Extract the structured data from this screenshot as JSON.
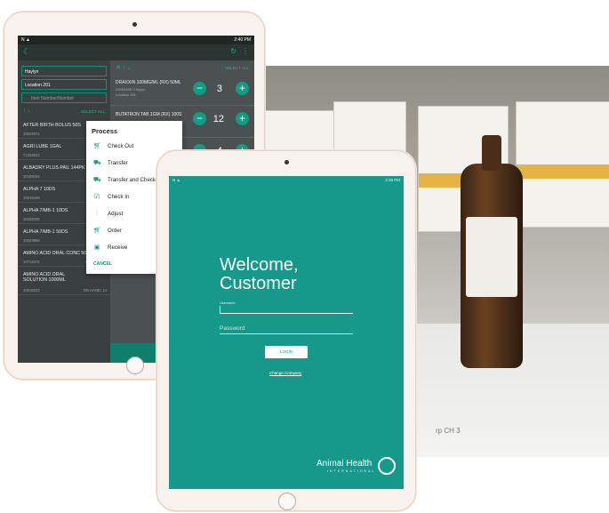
{
  "back_tablet": {
    "status_time": "2:40 PM",
    "filters": {
      "user": "Haylyn",
      "location": "Location 201",
      "item_number_placeholder": "Item Number/Number"
    },
    "select_all_left": "SELECT ALL",
    "select_all_right": "SELECT ALL",
    "items": [
      {
        "name": "AFTER BIRTH BOLUS 50S",
        "code": "10026971",
        "onhand": "ON"
      },
      {
        "name": "AGRI LUBE 1GAL",
        "code": "71263533",
        "onhand": "ON"
      },
      {
        "name": "ALBADRY PLUS PAIL 144PK",
        "code": "10189464",
        "onhand": "ON"
      },
      {
        "name": "ALPHA 7 10DS",
        "code": "10015449",
        "onhand": "ON"
      },
      {
        "name": "ALPHA 7/MB-1 10DS",
        "code": "10158425",
        "onhand": "ON"
      },
      {
        "name": "ALPHA 7/MB-1 50DS",
        "code": "10029956",
        "onhand": "ON"
      },
      {
        "name": "AMINO ACID ORAL CONC 500ML",
        "code": "10711676",
        "onhand": "ON HAND: 8"
      },
      {
        "name": "AMINO ACID ORAL SOLUTION 1000ML",
        "code": "10016223",
        "onhand": "ON HAND: 14"
      }
    ],
    "selected": [
      {
        "name": "DRAXXIN 100MG/ML (RX) 50ML",
        "sub1": "10050465 / Haylyn",
        "sub2": "Location 201",
        "qty": "3"
      },
      {
        "name": "BUTATRON TAB 1GM (RX) 100S",
        "sub1": "",
        "sub2": "",
        "qty": "12"
      },
      {
        "name": "",
        "sub1": "",
        "sub2": "",
        "qty": "4"
      }
    ],
    "menu": {
      "title": "Process",
      "items": [
        {
          "icon": "cart-icon",
          "label": "Check Out"
        },
        {
          "icon": "truck-icon",
          "label": "Transfer"
        },
        {
          "icon": "truck-icon",
          "label": "Transfer and Check C"
        },
        {
          "icon": "check-icon",
          "label": "Check In"
        },
        {
          "icon": "sliders-icon",
          "label": "Adjust"
        },
        {
          "icon": "cart-icon",
          "label": "Order"
        },
        {
          "icon": "box-icon",
          "label": "Receive"
        }
      ],
      "cancel": "CANCEL"
    }
  },
  "front_tablet": {
    "status_time": "2:39 PM",
    "welcome_line1": "Welcome,",
    "welcome_line2": "Customer",
    "username_label": "Username",
    "password_placeholder": "Password",
    "login_label": "LOGIN",
    "change_company": "Change Company",
    "brand_name": "Animal Health",
    "brand_sub": "INTERNATIONAL"
  },
  "photo_text": "rp CH 3",
  "colors": {
    "teal": "#16998a",
    "accent_green": "#0f9e84",
    "tablet_frame": "#f7f2ed"
  }
}
